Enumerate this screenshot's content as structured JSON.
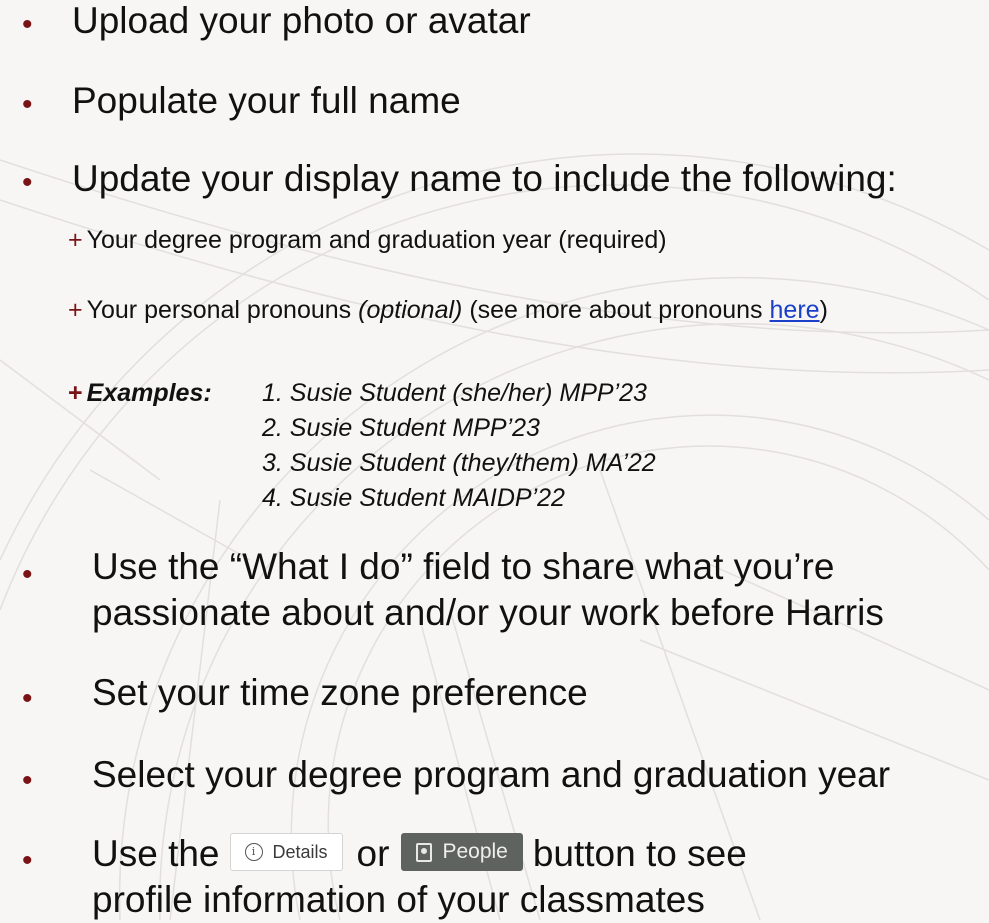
{
  "colors": {
    "accent": "#7a1315",
    "link": "#1a3fc9",
    "text": "#111111",
    "background": "#f7f6f5"
  },
  "bullets": {
    "glyph": "•",
    "upload": "Upload your photo or avatar",
    "fullname": "Populate your full name",
    "displayname": "Update your display name to include the following:",
    "whatido_line1": "Use the “What I do” field to share what you’re",
    "whatido_line2": "passionate about and/or your work before Harris",
    "timezone": "Set your time zone preference",
    "degree": "Select your degree program and graduation year",
    "usethe": "Use the",
    "or": "or",
    "button_to_see": "button to see",
    "profile_info": "profile information of your classmates"
  },
  "sub_items": {
    "plus": "+",
    "degree_year": "Your degree program and graduation year",
    "required": "(required)",
    "pronouns_lead": "Your personal pronouns",
    "optional": "(optional)",
    "see_more": "(see more about pronouns",
    "here_link": "here",
    "close_paren": ")"
  },
  "examples": {
    "label": "Examples:",
    "items": [
      "1. Susie Student (she/her) MPP’23",
      "2. Susie Student MPP’23",
      "3. Susie Student (they/them) MA’22",
      "4. Susie Student MAIDP’22"
    ]
  },
  "buttons": {
    "details_label": "Details",
    "details_icon": "info-icon",
    "people_label": "People",
    "people_icon": "address-book-icon"
  }
}
